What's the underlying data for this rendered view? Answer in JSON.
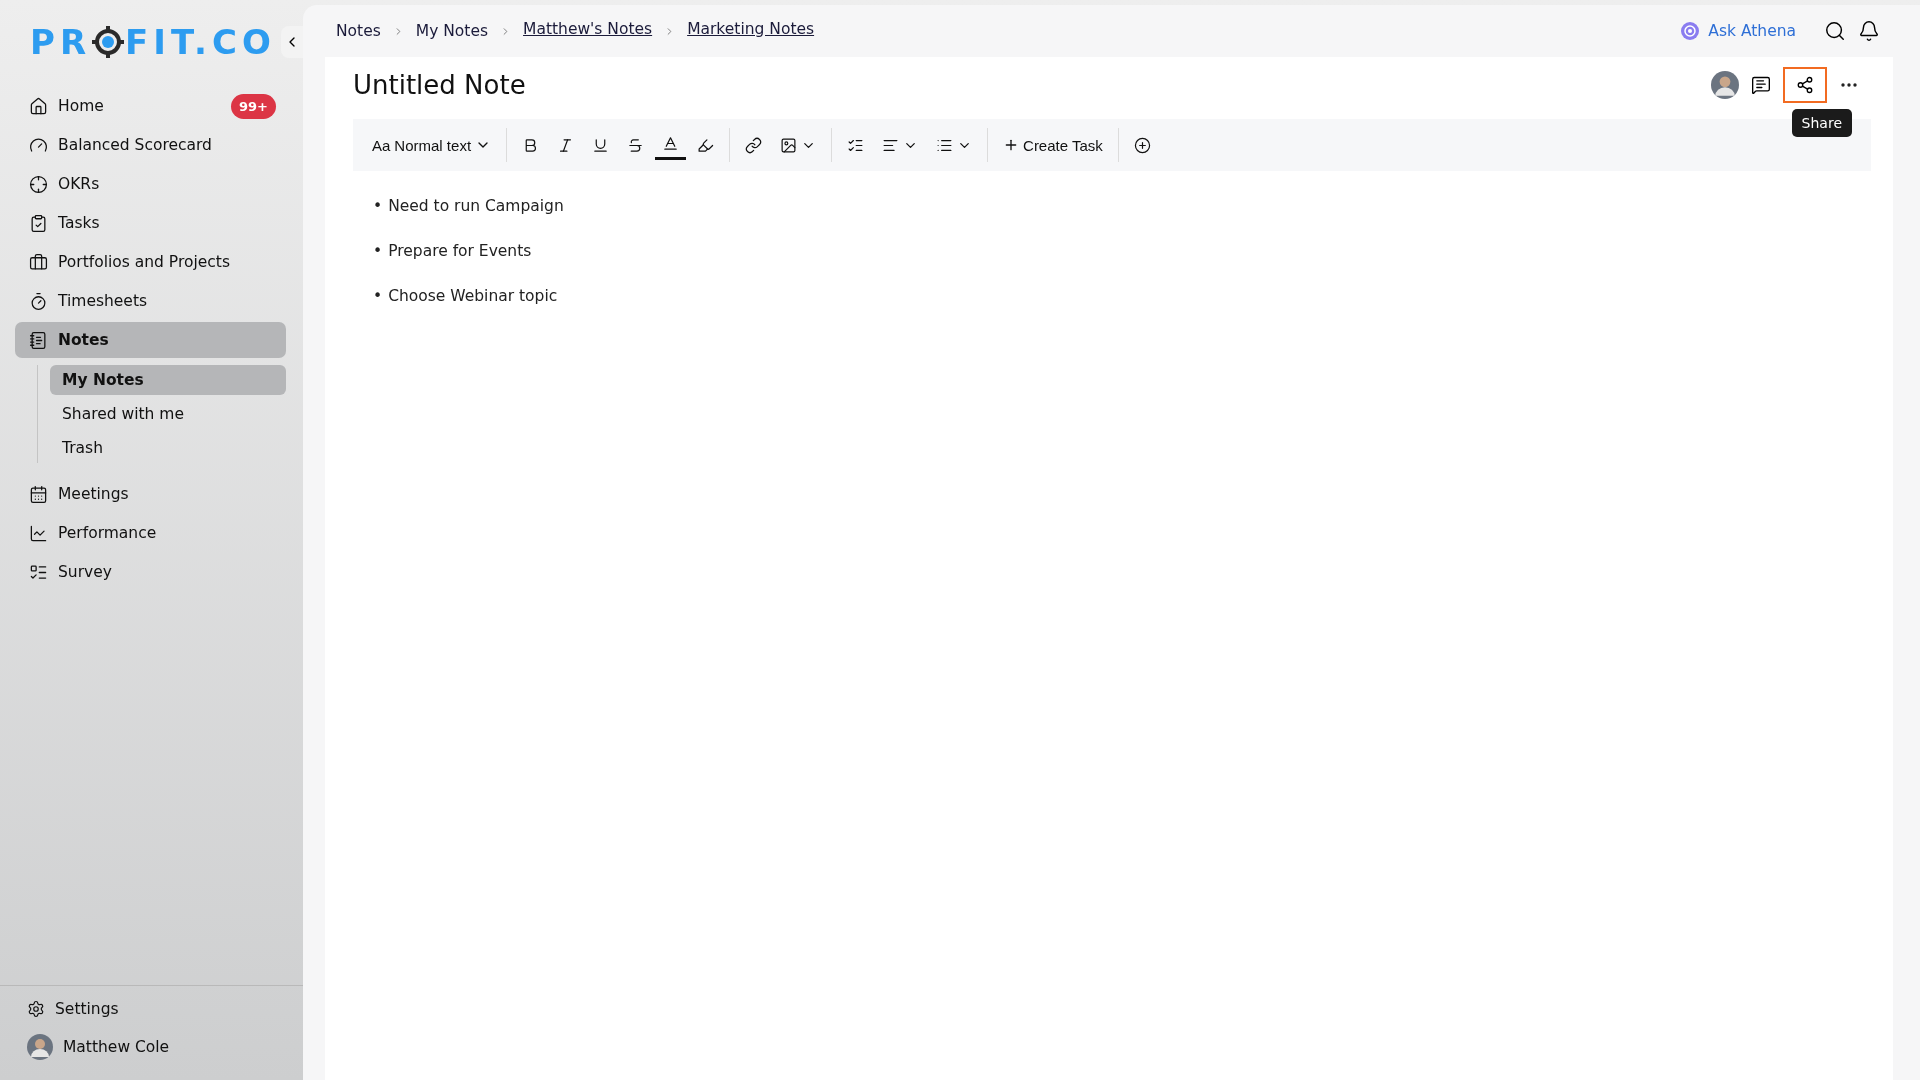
{
  "logo": {
    "before": "PR",
    "after": "FIT.CO"
  },
  "sidebar": {
    "items": [
      {
        "label": "Home",
        "selected": false,
        "badge": "99+"
      },
      {
        "label": "Balanced Scorecard",
        "selected": false
      },
      {
        "label": "OKRs",
        "selected": false
      },
      {
        "label": "Tasks",
        "selected": false
      },
      {
        "label": "Portfolios and Projects",
        "selected": false
      },
      {
        "label": "Timesheets",
        "selected": false
      },
      {
        "label": "Notes",
        "selected": true,
        "expanded": true,
        "children": [
          {
            "label": "My Notes",
            "selected": true
          },
          {
            "label": "Shared with me",
            "selected": false
          },
          {
            "label": "Trash",
            "selected": false
          }
        ]
      },
      {
        "label": "Meetings",
        "selected": false
      },
      {
        "label": "Performance",
        "selected": false
      },
      {
        "label": "Survey",
        "selected": false
      }
    ],
    "settings": "Settings",
    "user": "Matthew Cole"
  },
  "breadcrumb": [
    {
      "label": "Notes",
      "link": false
    },
    {
      "label": "My Notes",
      "link": false
    },
    {
      "label": "Matthew's Notes",
      "link": true
    },
    {
      "label": "Marketing Notes",
      "link": true
    }
  ],
  "ask_athena": "Ask Athena",
  "note": {
    "title": "Untitled Note",
    "share_highlighted": true,
    "tooltip": "Share",
    "toolbar": [
      {
        "kind": "style",
        "prefix": "Aa",
        "label": "Normal text"
      },
      {
        "kind": "sep"
      },
      {
        "kind": "bold"
      },
      {
        "kind": "italic"
      },
      {
        "kind": "underline"
      },
      {
        "kind": "strike"
      },
      {
        "kind": "color"
      },
      {
        "kind": "highlight"
      },
      {
        "kind": "sep"
      },
      {
        "kind": "link"
      },
      {
        "kind": "image"
      },
      {
        "kind": "sep"
      },
      {
        "kind": "checklist"
      },
      {
        "kind": "align"
      },
      {
        "kind": "list"
      },
      {
        "kind": "sep"
      },
      {
        "kind": "task",
        "label": "Create Task"
      },
      {
        "kind": "sep"
      },
      {
        "kind": "add"
      }
    ],
    "bullets": [
      {
        "marker": "•",
        "text": "Need to run Campaign"
      },
      {
        "marker": "•",
        "text": "Prepare for Events"
      },
      {
        "marker": "•",
        "text": "Choose Webinar topic"
      }
    ]
  }
}
